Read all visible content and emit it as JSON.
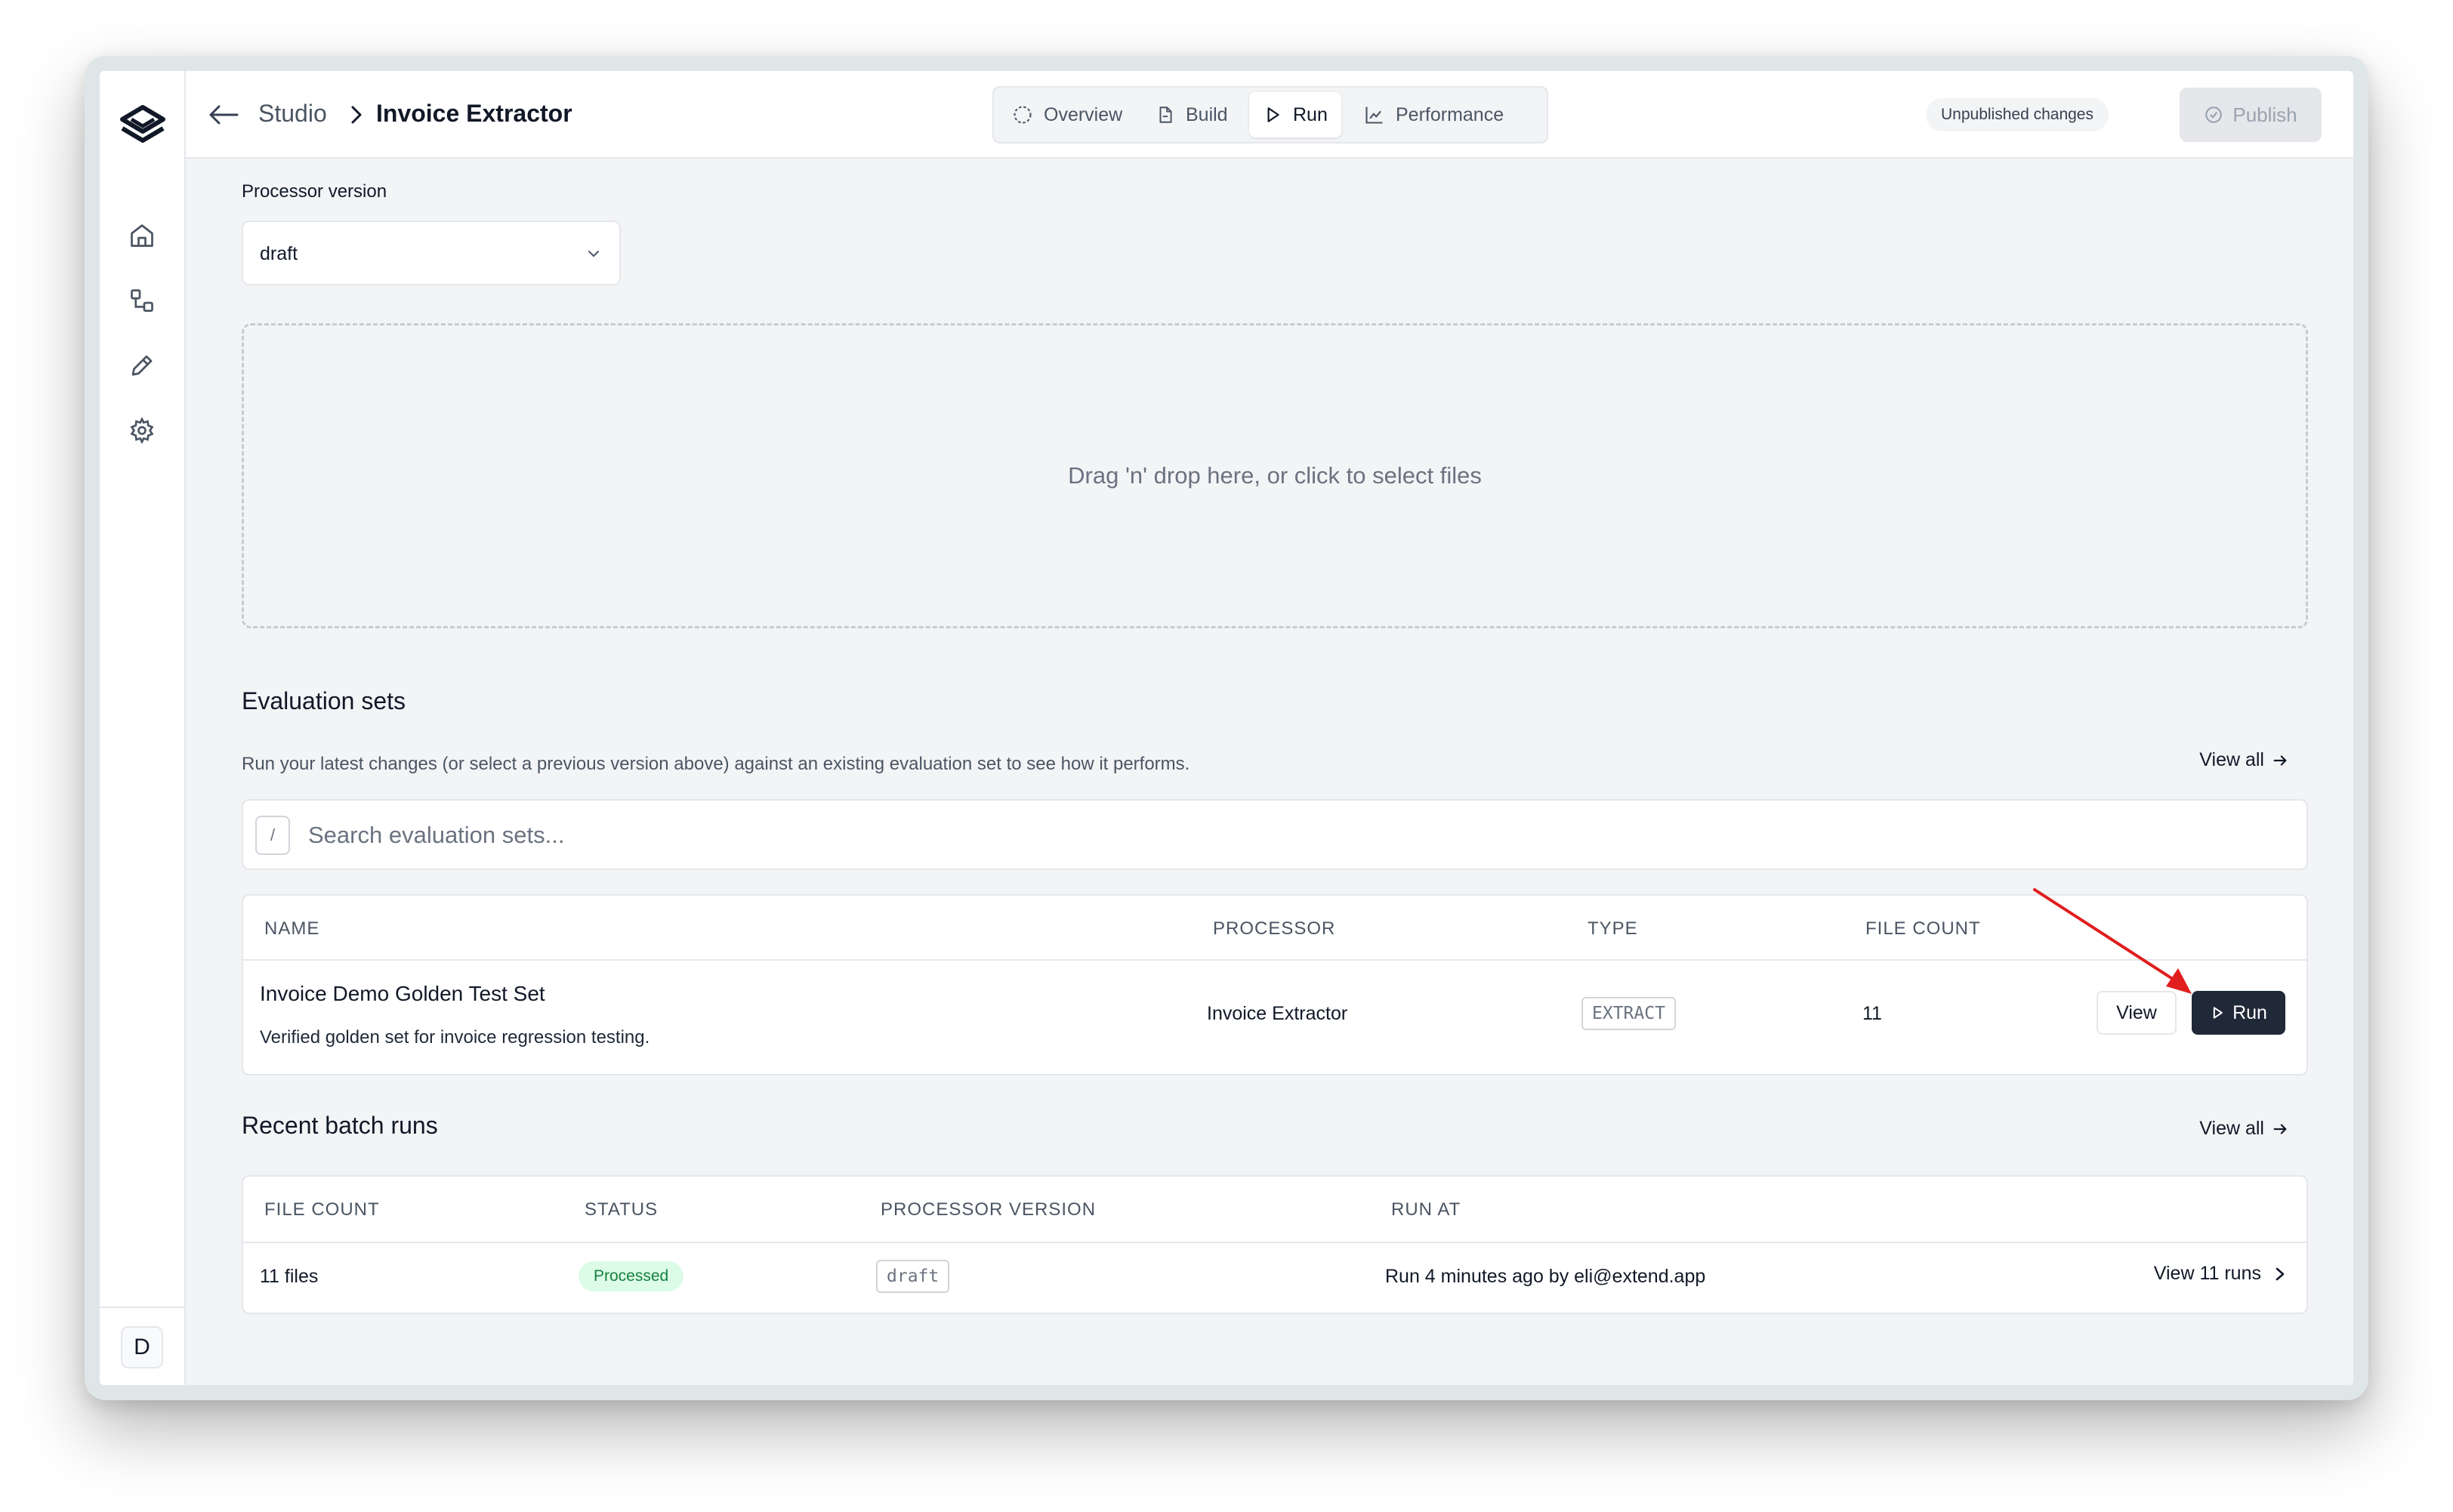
{
  "breadcrumb": {
    "parent": "Studio",
    "current": "Invoice Extractor"
  },
  "tabs": [
    {
      "label": "Overview",
      "icon": "dashed-circle-icon"
    },
    {
      "label": "Build",
      "icon": "file-icon"
    },
    {
      "label": "Run",
      "icon": "play-icon",
      "active": true
    },
    {
      "label": "Performance",
      "icon": "chart-icon"
    }
  ],
  "header": {
    "badge": "Unpublished changes",
    "publish_label": "Publish"
  },
  "sidebar": {
    "avatar_initial": "D"
  },
  "processor_version": {
    "label": "Processor version",
    "value": "draft"
  },
  "dropzone": {
    "text": "Drag 'n' drop here, or click to select files"
  },
  "evaluation_sets": {
    "title": "Evaluation sets",
    "description": "Run your latest changes (or select a previous version above) against an existing evaluation set to see how it performs.",
    "view_all": "View all",
    "search_placeholder": "Search evaluation sets...",
    "search_shortcut": "/",
    "columns": [
      "NAME",
      "PROCESSOR",
      "TYPE",
      "FILE COUNT"
    ],
    "rows": [
      {
        "name": "Invoice Demo Golden Test Set",
        "description": "Verified golden set for invoice regression testing.",
        "processor": "Invoice Extractor",
        "type": "EXTRACT",
        "file_count": "11",
        "view_label": "View",
        "run_label": "Run"
      }
    ]
  },
  "batch_runs": {
    "title": "Recent batch runs",
    "view_all": "View all",
    "columns": [
      "FILE COUNT",
      "STATUS",
      "PROCESSOR VERSION",
      "RUN AT"
    ],
    "rows": [
      {
        "file_count": "11 files",
        "status": "Processed",
        "processor_version": "draft",
        "run_at": "Run 4 minutes ago by eli@extend.app",
        "link": "View 11 runs"
      }
    ]
  },
  "colors": {
    "accent_dark": "#1f2937",
    "status_green": "#15803d",
    "annotation_red": "#e11d1d"
  }
}
